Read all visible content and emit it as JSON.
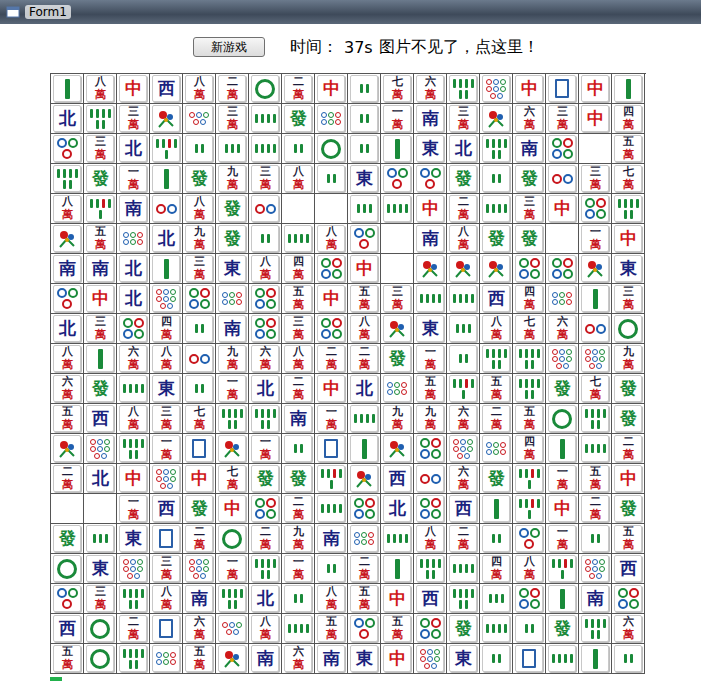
{
  "window": {
    "title": "Form1"
  },
  "toolbar": {
    "new_game_button": "新游戏",
    "time_label": "时间：",
    "time_value": "37s",
    "hint_link": "图片不见了，点这里！"
  },
  "progress": {
    "level": 0.02
  },
  "tile_colors": {
    "中": "#d01818",
    "發": "#1a8a3a",
    "東": "#1a237e",
    "南": "#1a237e",
    "西": "#1a237e",
    "北": "#1a237e"
  },
  "board": [
    [
      {
        "kind": "bamboo",
        "count": 1
      },
      "八萬",
      "中",
      "西",
      "八萬",
      "二萬",
      {
        "kind": "dots",
        "count": 1
      },
      "二萬",
      "中",
      {
        "kind": "bamboo",
        "count": 2
      },
      "七萬",
      "六萬",
      {
        "kind": "bamboo",
        "count": 6
      },
      {
        "kind": "dots",
        "count": 8
      },
      "中",
      {
        "kind": "white"
      },
      "中",
      {
        "kind": "bamboo",
        "count": 1
      }
    ],
    [
      "北",
      {
        "kind": "bamboo",
        "count": 6
      },
      "三萬",
      {
        "kind": "flower"
      },
      {
        "kind": "dots",
        "count": 5
      },
      "三萬",
      {
        "kind": "bamboo",
        "count": 4
      },
      "發",
      {
        "kind": "dots",
        "count": 6
      },
      {
        "kind": "bamboo",
        "count": 2
      },
      "一萬",
      "南",
      "三萬",
      {
        "kind": "flower"
      },
      "六萬",
      "三萬",
      "中",
      "四萬"
    ],
    [
      {
        "kind": "dots",
        "count": 3
      },
      "三萬",
      "北",
      {
        "kind": "bamboo",
        "count": 5
      },
      {
        "kind": "bamboo",
        "count": 2
      },
      {
        "kind": "bamboo",
        "count": 3
      },
      {
        "kind": "bamboo",
        "count": 4
      },
      {
        "kind": "bamboo",
        "count": 2
      },
      {
        "kind": "dots",
        "count": 1
      },
      {
        "kind": "bamboo",
        "count": 2
      },
      {
        "kind": "bamboo",
        "count": 1
      },
      "東",
      "北",
      {
        "kind": "bamboo",
        "count": 6
      },
      "南",
      {
        "kind": "dots",
        "count": 4
      },
      {
        "kind": "empty"
      },
      "五萬"
    ],
    [
      {
        "kind": "bamboo",
        "count": 6
      },
      "發",
      "一萬",
      {
        "kind": "bamboo",
        "count": 1
      },
      "發",
      "九萬",
      "三萬",
      "八萬",
      {
        "kind": "bamboo",
        "count": 2
      },
      "東",
      {
        "kind": "dots",
        "count": 3
      },
      {
        "kind": "dots",
        "count": 3
      },
      "發",
      {
        "kind": "bamboo",
        "count": 2
      },
      "發",
      {
        "kind": "dots",
        "count": 2
      },
      "三萬",
      "七萬"
    ],
    [
      "八萬",
      {
        "kind": "bamboo",
        "count": 5
      },
      "南",
      {
        "kind": "dots",
        "count": 2
      },
      "八萬",
      "發",
      {
        "kind": "dots",
        "count": 2
      },
      {
        "kind": "empty"
      },
      {
        "kind": "empty"
      },
      {
        "kind": "bamboo",
        "count": 3
      },
      {
        "kind": "bamboo",
        "count": 4
      },
      "中",
      "二萬",
      {
        "kind": "bamboo",
        "count": 4
      },
      "三萬",
      "中",
      {
        "kind": "dots",
        "count": 4
      },
      {
        "kind": "bamboo",
        "count": 6
      }
    ],
    [
      {
        "kind": "flower"
      },
      "五萬",
      {
        "kind": "dots",
        "count": 6
      },
      "北",
      "九萬",
      "發",
      {
        "kind": "bamboo",
        "count": 2
      },
      {
        "kind": "bamboo",
        "count": 4
      },
      "八萬",
      {
        "kind": "dots",
        "count": 3
      },
      {
        "kind": "empty"
      },
      "南",
      "八萬",
      "發",
      "發",
      {
        "kind": "empty"
      },
      "一萬",
      "中"
    ],
    [
      "南",
      "南",
      "北",
      {
        "kind": "bamboo",
        "count": 1
      },
      "三萬",
      "東",
      "八萬",
      "四萬",
      {
        "kind": "dots",
        "count": 4
      },
      "中",
      {
        "kind": "empty"
      },
      {
        "kind": "flower"
      },
      {
        "kind": "flower"
      },
      {
        "kind": "flower"
      },
      {
        "kind": "dots",
        "count": 4
      },
      {
        "kind": "dots",
        "count": 4
      },
      {
        "kind": "flower"
      },
      "東"
    ],
    [
      {
        "kind": "dots",
        "count": 3
      },
      "中",
      "北",
      {
        "kind": "dots",
        "count": 8
      },
      {
        "kind": "dots",
        "count": 4
      },
      {
        "kind": "dots",
        "count": 6
      },
      {
        "kind": "dots",
        "count": 4
      },
      "五萬",
      "中",
      "五萬",
      "三萬",
      {
        "kind": "bamboo",
        "count": 4
      },
      {
        "kind": "bamboo",
        "count": 4
      },
      "西",
      "四萬",
      {
        "kind": "dots",
        "count": 6
      },
      {
        "kind": "bamboo",
        "count": 1
      },
      "三萬"
    ],
    [
      "北",
      "三萬",
      {
        "kind": "dots",
        "count": 4
      },
      "四萬",
      {
        "kind": "bamboo",
        "count": 2
      },
      "南",
      {
        "kind": "dots",
        "count": 4
      },
      "三萬",
      {
        "kind": "dots",
        "count": 4
      },
      "八萬",
      {
        "kind": "flower"
      },
      "東",
      {
        "kind": "bamboo",
        "count": 3
      },
      "八萬",
      "七萬",
      "六萬",
      {
        "kind": "dots",
        "count": 2
      },
      {
        "kind": "dots",
        "count": 1
      }
    ],
    [
      "八萬",
      {
        "kind": "bamboo",
        "count": 1
      },
      "六萬",
      "八萬",
      {
        "kind": "dots",
        "count": 2
      },
      "九萬",
      "六萬",
      "八萬",
      "二萬",
      "二萬",
      "發",
      "一萬",
      {
        "kind": "bamboo",
        "count": 2
      },
      {
        "kind": "bamboo",
        "count": 6
      },
      {
        "kind": "bamboo",
        "count": 6
      },
      {
        "kind": "dots",
        "count": 8
      },
      {
        "kind": "dots",
        "count": 8
      },
      "九萬"
    ],
    [
      "六萬",
      "發",
      {
        "kind": "bamboo",
        "count": 4
      },
      "東",
      {
        "kind": "bamboo",
        "count": 2
      },
      "一萬",
      "北",
      "二萬",
      "中",
      "北",
      {
        "kind": "dots",
        "count": 6
      },
      "五萬",
      {
        "kind": "bamboo",
        "count": 5
      },
      "五萬",
      {
        "kind": "bamboo",
        "count": 6
      },
      "發",
      "七萬",
      "發"
    ],
    [
      "五萬",
      "西",
      "八萬",
      "三萬",
      "七萬",
      {
        "kind": "bamboo",
        "count": 6
      },
      {
        "kind": "bamboo",
        "count": 6
      },
      "南",
      "一萬",
      {
        "kind": "bamboo",
        "count": 4
      },
      "九萬",
      "九萬",
      "六萬",
      "二萬",
      "五萬",
      {
        "kind": "dots",
        "count": 1
      },
      {
        "kind": "bamboo",
        "count": 6
      },
      "發"
    ],
    [
      {
        "kind": "flower"
      },
      {
        "kind": "dots",
        "count": 8
      },
      {
        "kind": "bamboo",
        "count": 6
      },
      "一萬",
      {
        "kind": "white"
      },
      {
        "kind": "flower"
      },
      "一萬",
      {
        "kind": "bamboo",
        "count": 2
      },
      {
        "kind": "white"
      },
      {
        "kind": "bamboo",
        "count": 1
      },
      {
        "kind": "flower"
      },
      {
        "kind": "dots",
        "count": 4
      },
      {
        "kind": "dots",
        "count": 8
      },
      {
        "kind": "dots",
        "count": 6
      },
      "四萬",
      {
        "kind": "bamboo",
        "count": 1
      },
      {
        "kind": "bamboo",
        "count": 4
      },
      "二萬"
    ],
    [
      "二萬",
      "北",
      "中",
      {
        "kind": "dots",
        "count": 8
      },
      "中",
      "七萬",
      "發",
      "發",
      {
        "kind": "bamboo",
        "count": 5
      },
      {
        "kind": "flower"
      },
      "西",
      {
        "kind": "dots",
        "count": 2
      },
      "六萬",
      "發",
      {
        "kind": "bamboo",
        "count": 5
      },
      "一萬",
      "五萬",
      "中"
    ],
    [
      {
        "kind": "empty"
      },
      {
        "kind": "empty"
      },
      "一萬",
      "西",
      "發",
      "中",
      {
        "kind": "dots",
        "count": 4
      },
      "二萬",
      {
        "kind": "bamboo",
        "count": 4
      },
      {
        "kind": "dots",
        "count": 4
      },
      "北",
      {
        "kind": "dots",
        "count": 4
      },
      "西",
      {
        "kind": "bamboo",
        "count": 1
      },
      {
        "kind": "bamboo",
        "count": 5
      },
      "中",
      "二萬",
      "發"
    ],
    [
      "發",
      {
        "kind": "bamboo",
        "count": 3
      },
      "東",
      {
        "kind": "white"
      },
      "二萬",
      {
        "kind": "dots",
        "count": 1
      },
      "二萬",
      "九萬",
      "南",
      {
        "kind": "dots",
        "count": 6
      },
      {
        "kind": "bamboo",
        "count": 4
      },
      "八萬",
      "二萬",
      {
        "kind": "bamboo",
        "count": 2
      },
      {
        "kind": "dots",
        "count": 3
      },
      "一萬",
      {
        "kind": "bamboo",
        "count": 2
      },
      "五萬"
    ],
    [
      {
        "kind": "dots",
        "count": 1
      },
      "東",
      {
        "kind": "dots",
        "count": 8
      },
      "三萬",
      {
        "kind": "dots",
        "count": 8
      },
      "一萬",
      {
        "kind": "bamboo",
        "count": 6
      },
      "一萬",
      {
        "kind": "bamboo",
        "count": 2
      },
      "二萬",
      {
        "kind": "bamboo",
        "count": 1
      },
      {
        "kind": "bamboo",
        "count": 6
      },
      {
        "kind": "bamboo",
        "count": 4
      },
      "四萬",
      "八萬",
      {
        "kind": "bamboo",
        "count": 5
      },
      {
        "kind": "dots",
        "count": 8
      },
      "西"
    ],
    [
      {
        "kind": "dots",
        "count": 3
      },
      "三萬",
      {
        "kind": "bamboo",
        "count": 6
      },
      "八萬",
      "南",
      {
        "kind": "bamboo",
        "count": 6
      },
      "北",
      {
        "kind": "bamboo",
        "count": 2
      },
      "八萬",
      "五萬",
      "中",
      "西",
      {
        "kind": "bamboo",
        "count": 6
      },
      {
        "kind": "bamboo",
        "count": 3
      },
      {
        "kind": "dots",
        "count": 4
      },
      {
        "kind": "bamboo",
        "count": 1
      },
      "南",
      {
        "kind": "dots",
        "count": 4
      }
    ],
    [
      "西",
      {
        "kind": "dots",
        "count": 1
      },
      "二萬",
      {
        "kind": "white"
      },
      "六萬",
      {
        "kind": "dots",
        "count": 5
      },
      "八萬",
      {
        "kind": "bamboo",
        "count": 4
      },
      "五萬",
      {
        "kind": "dots",
        "count": 3
      },
      "五萬",
      {
        "kind": "dots",
        "count": 4
      },
      "發",
      {
        "kind": "bamboo",
        "count": 4
      },
      {
        "kind": "bamboo",
        "count": 2
      },
      "發",
      {
        "kind": "bamboo",
        "count": 6
      },
      "六萬"
    ],
    [
      "五萬",
      {
        "kind": "dots",
        "count": 1
      },
      {
        "kind": "bamboo",
        "count": 6
      },
      {
        "kind": "dots",
        "count": 6
      },
      "五萬",
      {
        "kind": "flower"
      },
      "南",
      "六萬",
      "南",
      "東",
      "中",
      {
        "kind": "dots",
        "count": 8
      },
      "東",
      {
        "kind": "bamboo",
        "count": 2
      },
      {
        "kind": "white"
      },
      {
        "kind": "bamboo",
        "count": 4
      },
      {
        "kind": "bamboo",
        "count": 1
      },
      {
        "kind": "bamboo",
        "count": 2
      }
    ]
  ]
}
